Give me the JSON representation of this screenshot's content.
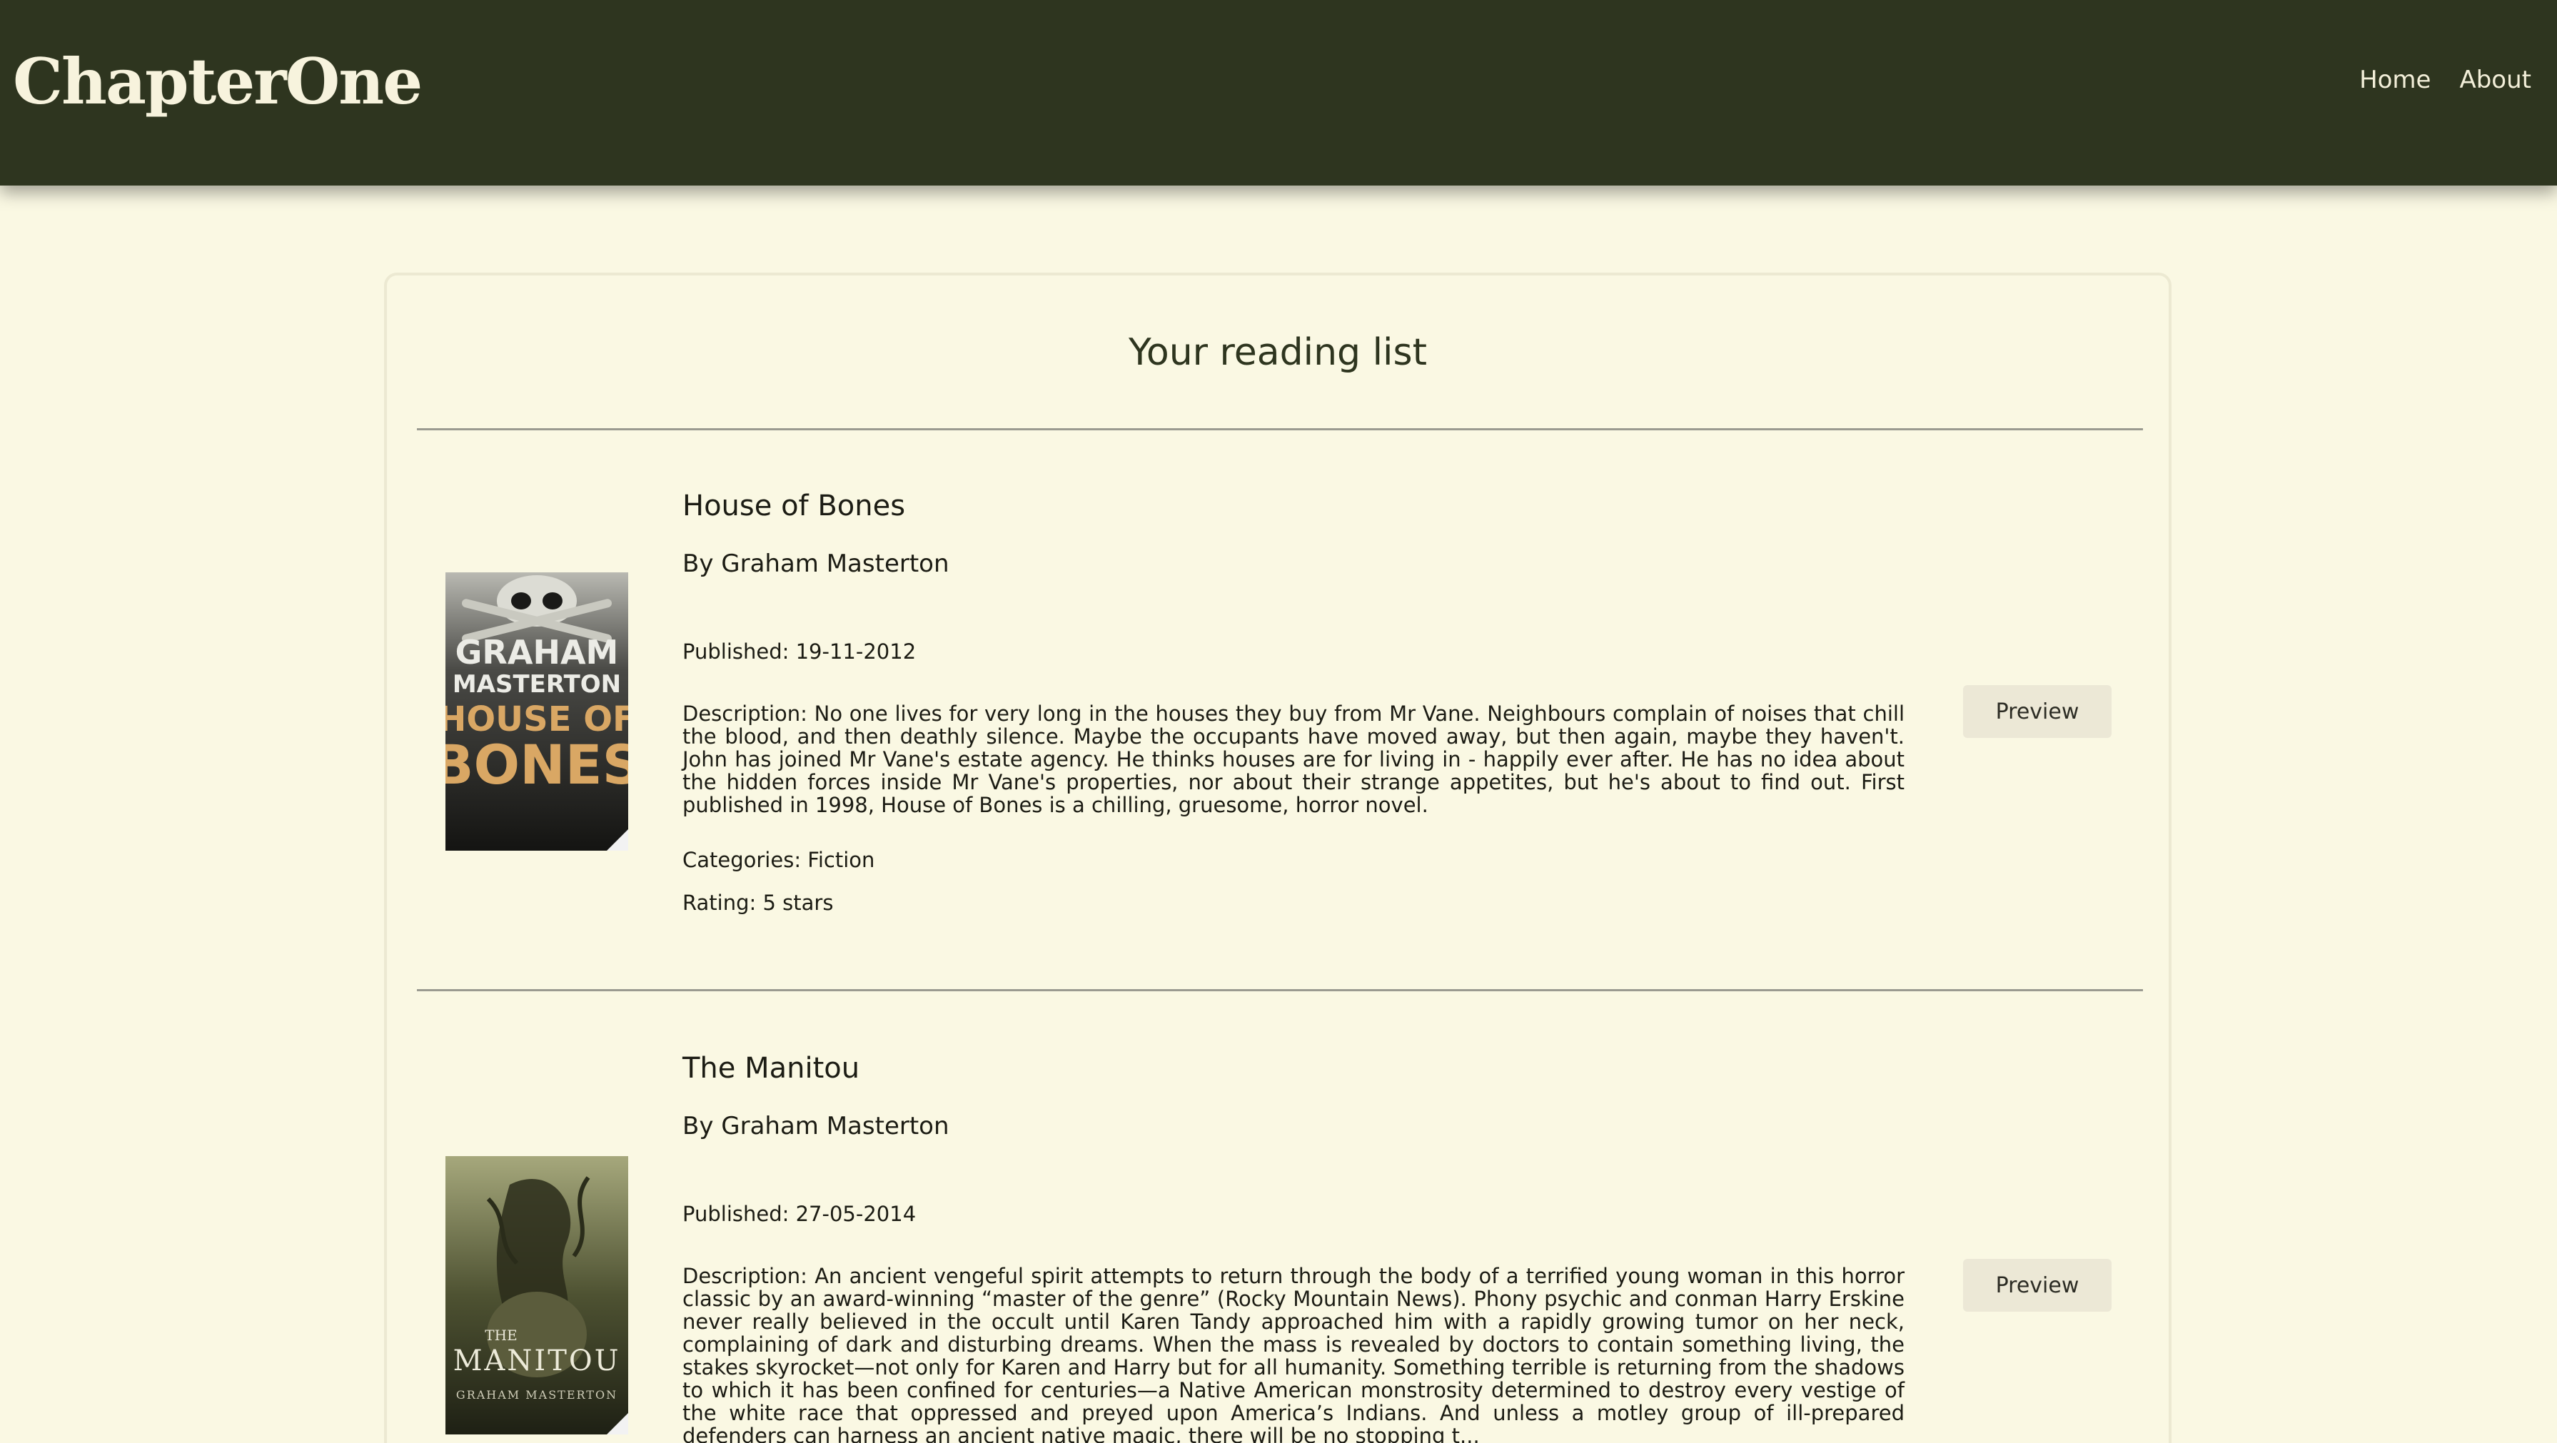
{
  "header": {
    "logo": "ChapterOne",
    "nav": [
      {
        "label": "Home"
      },
      {
        "label": "About"
      }
    ]
  },
  "main": {
    "title": "Your reading list",
    "books": [
      {
        "title": "House of Bones",
        "author": "By Graham Masterton",
        "published": "Published: 19-11-2012",
        "description": "Description: No one lives for very long in the houses they buy from Mr Vane. Neighbours complain of noises that chill the blood, and then deathly silence. Maybe the occupants have moved away, but then again, maybe they haven't. John has joined Mr Vane's estate agency. He thinks houses are for living in - happily ever after. He has no idea about the hidden forces inside Mr Vane's properties, nor about their strange appetites, but he's about to find out. First published in 1998, House of Bones is a chilling, gruesome, horror novel.",
        "categories": "Categories: Fiction",
        "rating": "Rating: 5 stars",
        "preview_label": "Preview",
        "cover": {
          "author_lines": [
            "GRAHAM",
            "MASTERTON"
          ],
          "title_lines": [
            "HOUSE OF",
            "BONES"
          ]
        }
      },
      {
        "title": "The Manitou",
        "author": "By Graham Masterton",
        "published": "Published: 27-05-2014",
        "description": "Description: An ancient vengeful spirit attempts to return through the body of a terrified young woman in this horror classic by an award-winning “master of the genre” (Rocky Mountain News). Phony psychic and conman Harry Erskine never really believed in the occult until Karen Tandy approached him with a rapidly growing tumor on her neck, complaining of dark and disturbing dreams. When the mass is revealed by doctors to contain something living, the stakes skyrocket—not only for Karen and Harry but for all humanity. Something terrible is returning from the shadows to which it has been confined for centuries—a Native American monstrosity determined to destroy every vestige of the white race that oppressed and preyed upon America’s Indians. And unless a motley group of ill-prepared defenders can harness an ancient native magic, there will be no stopping t...",
        "preview_label": "Preview",
        "cover": {
          "title_small": "THE",
          "title_big": "MANITOU",
          "author_line": "GRAHAM MASTERTON"
        }
      }
    ]
  }
}
